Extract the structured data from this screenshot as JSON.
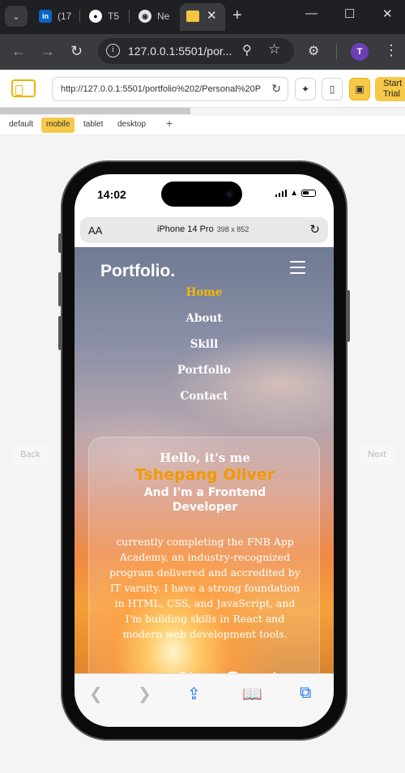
{
  "browser": {
    "tabs": [
      {
        "label": "(17",
        "icon": "linkedin-icon"
      },
      {
        "label": "T5",
        "icon": "github-icon"
      },
      {
        "label": "Ne",
        "icon": "chrome-icon"
      }
    ],
    "active_tab_icon": "responsive-viewer-icon",
    "url": "127.0.0.1:5501/por...",
    "profile_initial": "T"
  },
  "extension": {
    "url": "http://127.0.0.1:5501/portfolio%202/Personal%20P",
    "trial_line1": "Start",
    "trial_line2": "Trial",
    "progress": 0.47,
    "device_tabs": [
      "default",
      "mobile",
      "tablet",
      "desktop"
    ],
    "active_device": "mobile",
    "back_label": "Back",
    "next_label": "Next"
  },
  "device": {
    "time": "14:02",
    "aa_label": "AA",
    "model": "iPhone 14 Pro",
    "size": "398 x 852"
  },
  "site": {
    "brand": "Portfolio.",
    "nav": [
      "Home",
      "About",
      "Skill",
      "Portfolio",
      "Contact"
    ],
    "active_nav": "Home",
    "hello": "Hello, it's me",
    "name": "Tshepang Oliver",
    "role": "And I'm a Frontend Developer",
    "bio": "currently completing the FNB App Academy, an industry-recognized program delivered and accredited by IT varsity. I have a strong foundation in HTML, CSS, and JavaScript, and I'm building skills in React and modern web development tools.",
    "socials": [
      "github-icon",
      "x-icon",
      "instagram-icon",
      "linkedin-icon"
    ],
    "colors": {
      "accent": "#f5b800",
      "name": "#f29a00"
    }
  }
}
